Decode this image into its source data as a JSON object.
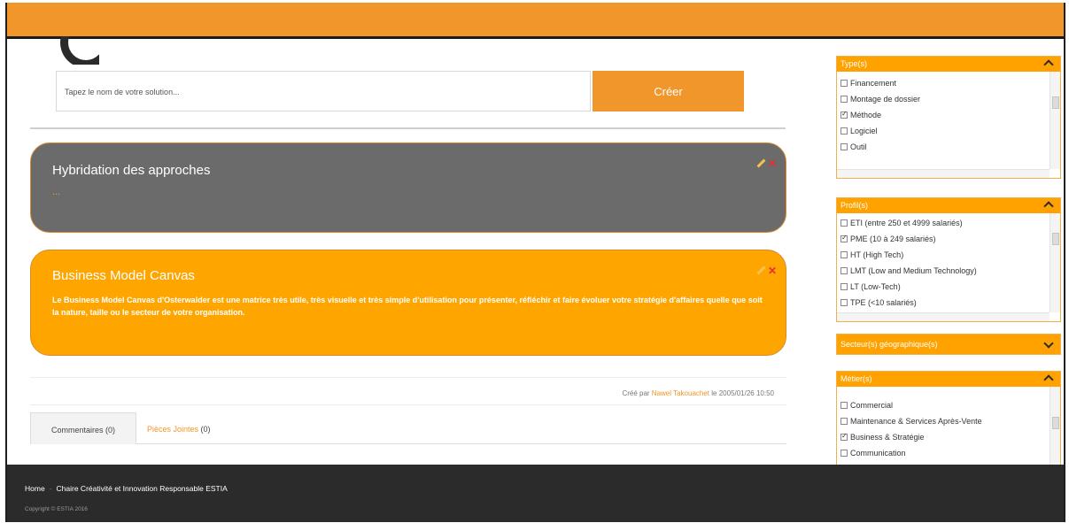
{
  "search": {
    "placeholder": "Tapez le nom de votre solution...",
    "create_label": "Créer"
  },
  "cards": [
    {
      "title": "Hybridation des approches",
      "text": "...",
      "color": "#6b6b6b"
    },
    {
      "title": "Business Model Canvas",
      "text": "Le Business Model Canvas d'Osterwalder est une matrice très utile, très visuelle et très simple d'utilisation pour présenter, réfléchir et faire évoluer votre stratégie d'affaires quelle que soit la nature, taille ou le secteur de votre organisation.",
      "color": "#ffa500"
    }
  ],
  "meta": {
    "prefix": "Créé par",
    "author": "Nawel Takouachet",
    "suffix": "le 2005/01/26 10:50"
  },
  "tabs": {
    "comments": "Commentaires (0)",
    "attachments_label": "Pièces Jointes",
    "attachments_count": "(0)"
  },
  "sidebar": {
    "types": {
      "title": "Type(s)",
      "items": [
        {
          "label": "Financement",
          "checked": false
        },
        {
          "label": "Montage de dossier",
          "checked": false
        },
        {
          "label": "Méthode",
          "checked": true
        },
        {
          "label": "Logiciel",
          "checked": false
        },
        {
          "label": "Outil",
          "checked": false
        }
      ]
    },
    "profiles": {
      "title": "Profil(s)",
      "items": [
        {
          "label": "ETI (entre 250 et 4999 salariés)",
          "checked": false
        },
        {
          "label": "PME (10 à 249 salariés)",
          "checked": true
        },
        {
          "label": "HT (High Tech)",
          "checked": false
        },
        {
          "label": "LMT (Low and Medium Technology)",
          "checked": false
        },
        {
          "label": "LT (Low-Tech)",
          "checked": false
        },
        {
          "label": "TPE (<10 salariés)",
          "checked": false
        }
      ]
    },
    "sectors": {
      "title": "Secteur(s) géographique(s)"
    },
    "jobs": {
      "title": "Métier(s)",
      "items": [
        {
          "label": "Commercial",
          "checked": false
        },
        {
          "label": "Maintenance & Services Après-Vente",
          "checked": false
        },
        {
          "label": "Business & Stratégie",
          "checked": true
        },
        {
          "label": "Communication",
          "checked": false
        }
      ]
    }
  },
  "footer": {
    "home": "Home",
    "chair": "Chaire Créativité et Innovation Responsable ESTIA",
    "copyright": "Copyright © ESTIA 2016"
  },
  "colors": {
    "accent": "#f0962a",
    "dark": "#2b2b2b"
  }
}
